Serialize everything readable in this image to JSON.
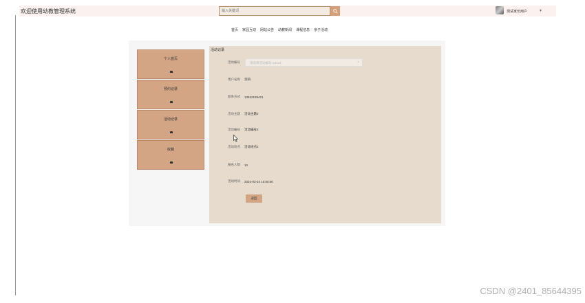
{
  "header": {
    "site_title": "欢迎使用幼教管理系统",
    "search_placeholder": "输入关键词",
    "username": "测试家长用户",
    "caret": "▾"
  },
  "nav": {
    "items": [
      "首页",
      "家园互动",
      "网站公告",
      "幼教新闻",
      "课程信息",
      "亲子活动"
    ]
  },
  "sidebar": {
    "items": [
      {
        "label": "个人首页",
        "icon": "home-icon"
      },
      {
        "label": "预约记录",
        "icon": "calendar-icon"
      },
      {
        "label": "活动记录",
        "icon": "activity-icon"
      },
      {
        "label": "收藏",
        "icon": "star-icon"
      }
    ]
  },
  "detail": {
    "title": "活动记录",
    "select_label": "活动编号",
    "select_placeholder": "请选择活动编号-ad123",
    "select_clear": "×",
    "fields": [
      {
        "label": "用户名称",
        "value": "李四"
      },
      {
        "label": "联系方式",
        "value": "13532189421"
      },
      {
        "label": "活动主题",
        "value": "活动主题2"
      },
      {
        "label": "活动编号",
        "value": "活动编号2"
      },
      {
        "label": "活动地点",
        "value": "活动地点2"
      },
      {
        "label": "报名人数",
        "value": "10"
      },
      {
        "label": "活动时间",
        "value": "2024-03-24 10:50:00"
      }
    ],
    "back_button": "返回"
  },
  "watermark": "CSDN @2401_85644395",
  "colors": {
    "accent": "#d3a584",
    "content_bg": "#e6dbcd",
    "topbar_bg": "#fbf1ef"
  }
}
